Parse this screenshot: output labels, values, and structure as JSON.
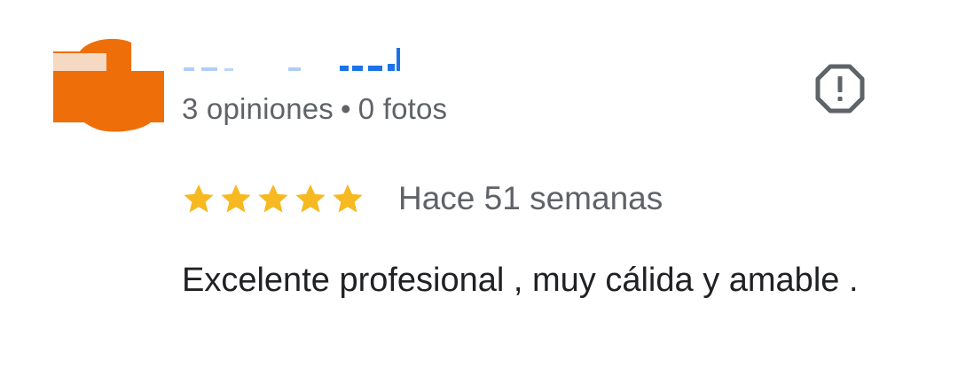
{
  "review": {
    "author_stats": {
      "reviews": "3 opiniones",
      "separator": "•",
      "photos": "0 fotos"
    },
    "rating": {
      "stars": 5,
      "max": 5,
      "color": "#f6b921"
    },
    "time_ago": "Hace 51 semanas",
    "text": "Excelente profesional , muy cálida y amable ."
  },
  "icons": {
    "avatar": "avatar-redacted",
    "report": "report-octagon-icon",
    "star": "star-icon"
  },
  "colors": {
    "avatar_orange": "#ee6f0a",
    "avatar_highlight": "#f6d9c3",
    "name_blue": "#1a73e8",
    "secondary_text": "#5f6368",
    "primary_text": "#202124"
  }
}
